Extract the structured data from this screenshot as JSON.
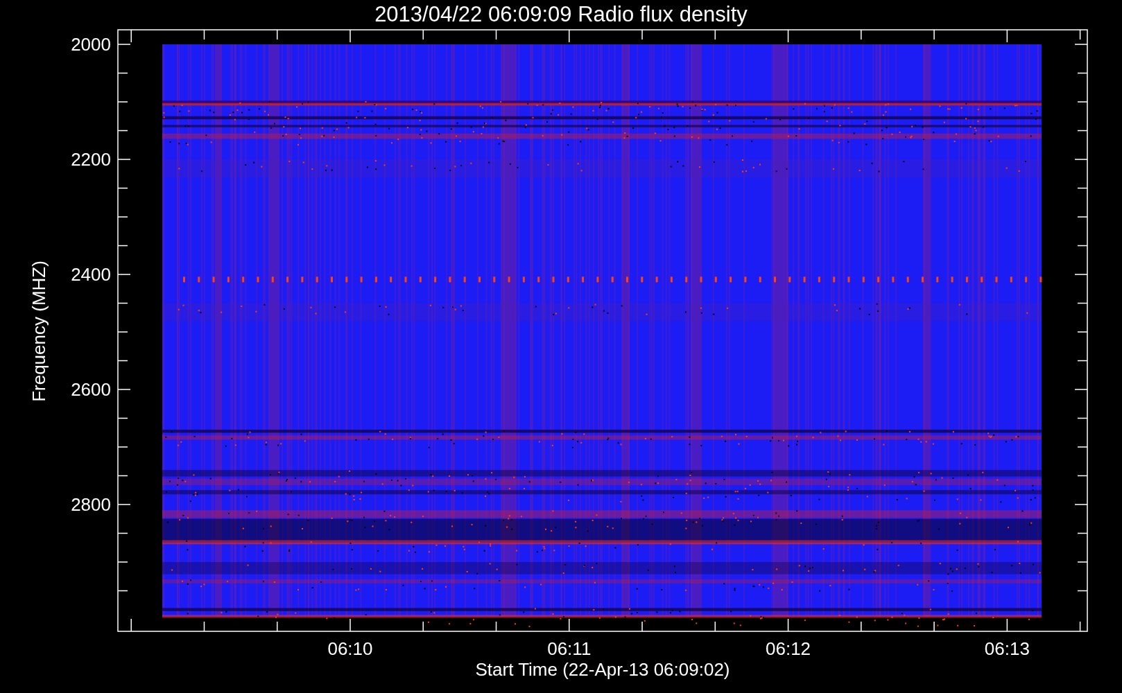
{
  "chart": {
    "title": "2013/04/22 06:09:09 Radio flux density",
    "y_axis": {
      "label": "Frequency (MHZ)",
      "tick_labels": [
        "2000",
        "2200",
        "2400",
        "2600",
        "2800"
      ]
    },
    "x_axis": {
      "label": "Start Time (22-Apr-13 06:09:02)",
      "tick_labels": [
        "06:10",
        "06:11",
        "06:12",
        "06:13"
      ]
    }
  }
}
